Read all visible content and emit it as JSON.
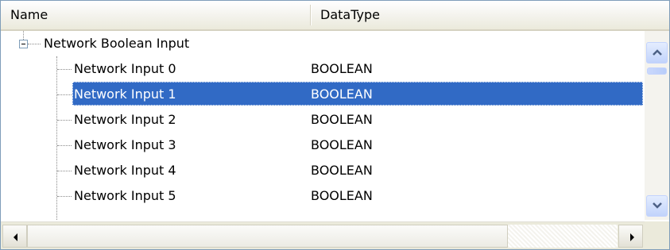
{
  "columns": {
    "name": "Name",
    "datatype": "DataType"
  },
  "tree": {
    "parent": {
      "label": "Network Boolean Input",
      "expander": "minus-icon"
    },
    "children": [
      {
        "name": "Network Input 0",
        "type": "BOOLEAN"
      },
      {
        "name": "Network Input 1",
        "type": "BOOLEAN",
        "selected": true
      },
      {
        "name": "Network Input 2",
        "type": "BOOLEAN"
      },
      {
        "name": "Network Input 3",
        "type": "BOOLEAN"
      },
      {
        "name": "Network Input 4",
        "type": "BOOLEAN"
      },
      {
        "name": "Network Input 5",
        "type": "BOOLEAN"
      }
    ]
  },
  "scrollbars": {
    "vertical": {
      "up_icon": "chevron-up-icon",
      "down_icon": "chevron-down-icon",
      "position": 0.0
    },
    "horizontal": {
      "left_icon": "arrow-left-icon",
      "right_icon": "arrow-right-icon",
      "position": 0.0
    }
  },
  "colors": {
    "selection": "#316ac5",
    "header": "#ebeadb",
    "border": "#7f9db9"
  }
}
